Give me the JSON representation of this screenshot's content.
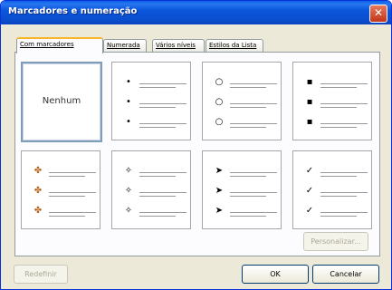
{
  "window": {
    "title": "Marcadores e numeração",
    "close_label": "✕"
  },
  "tabs": [
    {
      "label": "Com marcadores",
      "active": true
    },
    {
      "label": "Numerada",
      "active": false
    },
    {
      "label": "Vários níveis",
      "active": false
    },
    {
      "label": "Estilos da Lista",
      "active": false
    }
  ],
  "gallery": {
    "none_label": "Nenhum",
    "bullets": [
      "•",
      "○",
      "▪",
      "✤",
      "✧",
      "➤",
      "✓"
    ]
  },
  "buttons": {
    "customize": "Personalizar...",
    "reset": "Redefinir",
    "ok": "OK",
    "cancel": "Cancelar"
  }
}
